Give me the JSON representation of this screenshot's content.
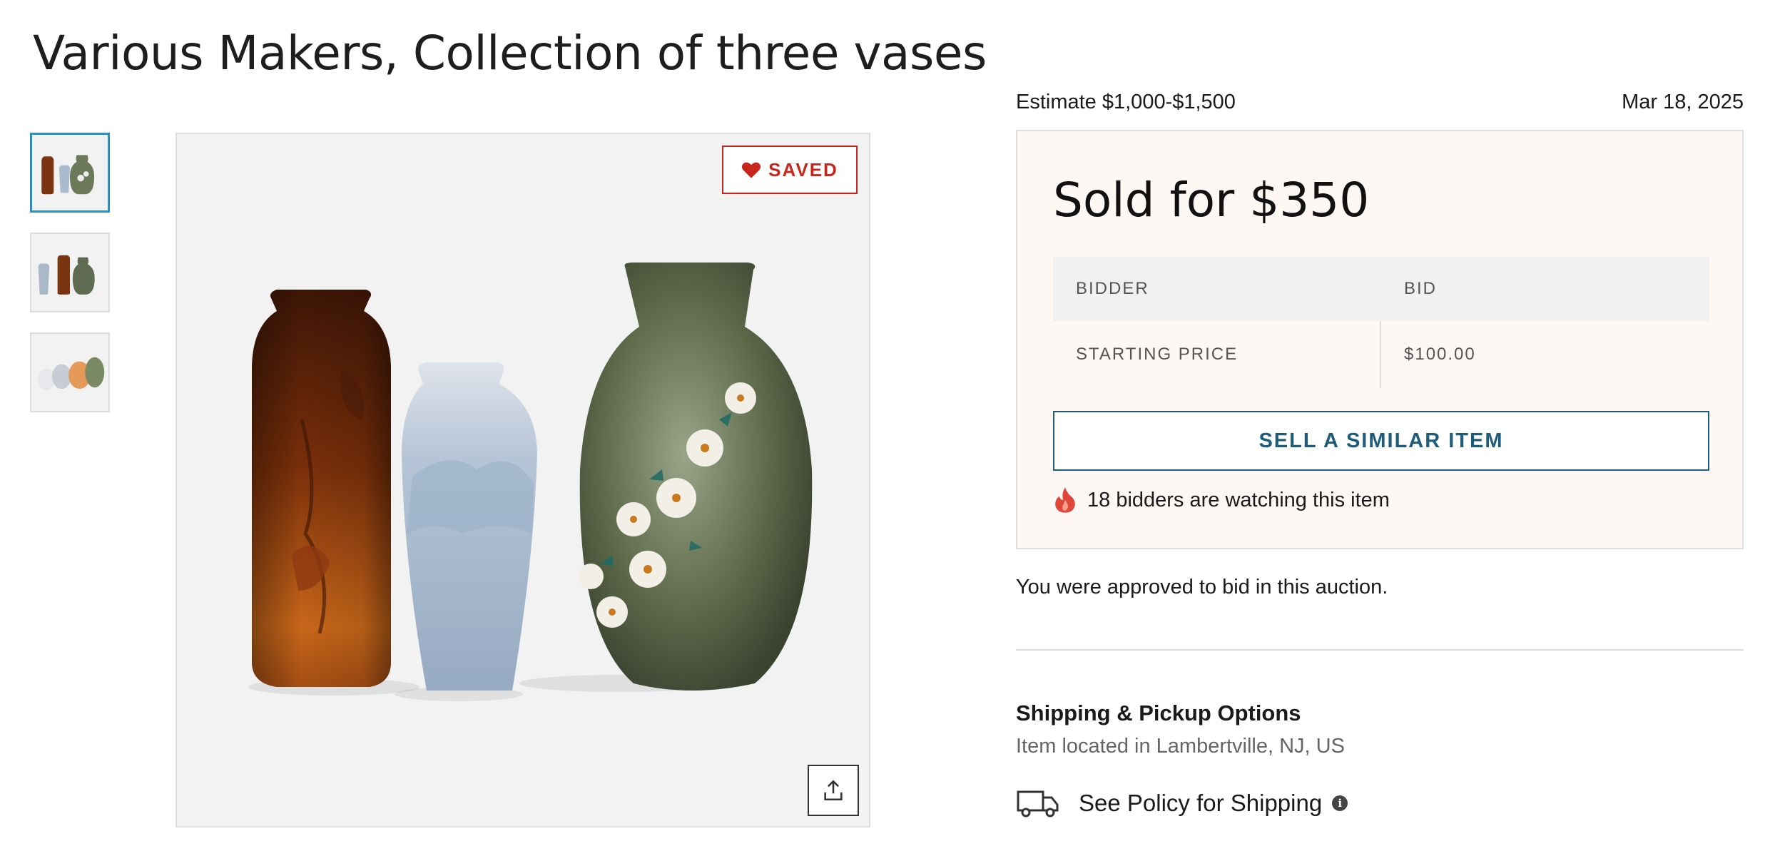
{
  "lot": {
    "title": "Various Makers, Collection of three vases"
  },
  "gallery": {
    "thumbnails": [
      {
        "icon": "vase-thumbnail-1",
        "active": true
      },
      {
        "icon": "vase-thumbnail-2",
        "active": false
      },
      {
        "icon": "vase-thumbnail-3",
        "active": false
      }
    ],
    "saved_label": "SAVED",
    "saved_icon": "heart-icon",
    "share_icon": "share-icon"
  },
  "auction": {
    "estimate": "Estimate $1,000-$1,500",
    "date": "Mar 18, 2025",
    "sold_label": "Sold for $350",
    "table": {
      "headers": [
        "BIDDER",
        "BID"
      ],
      "rows": [
        [
          "STARTING PRICE",
          "$100.00"
        ]
      ]
    },
    "sell_button": "SELL A SIMILAR ITEM",
    "watching_text": "18 bidders are watching this item",
    "watching_icon": "flame-icon",
    "approved_text": "You were approved to bid in this auction."
  },
  "shipping": {
    "title": "Shipping & Pickup Options",
    "location": "Item located in Lambertville, NJ, US",
    "policy_link": "See Policy for Shipping",
    "truck_icon": "truck-icon",
    "info_icon": "info-icon"
  },
  "colors": {
    "accent_blue": "#1d5c7a",
    "saved_red": "#c8261d",
    "panel_bg": "#fdf8f4"
  }
}
